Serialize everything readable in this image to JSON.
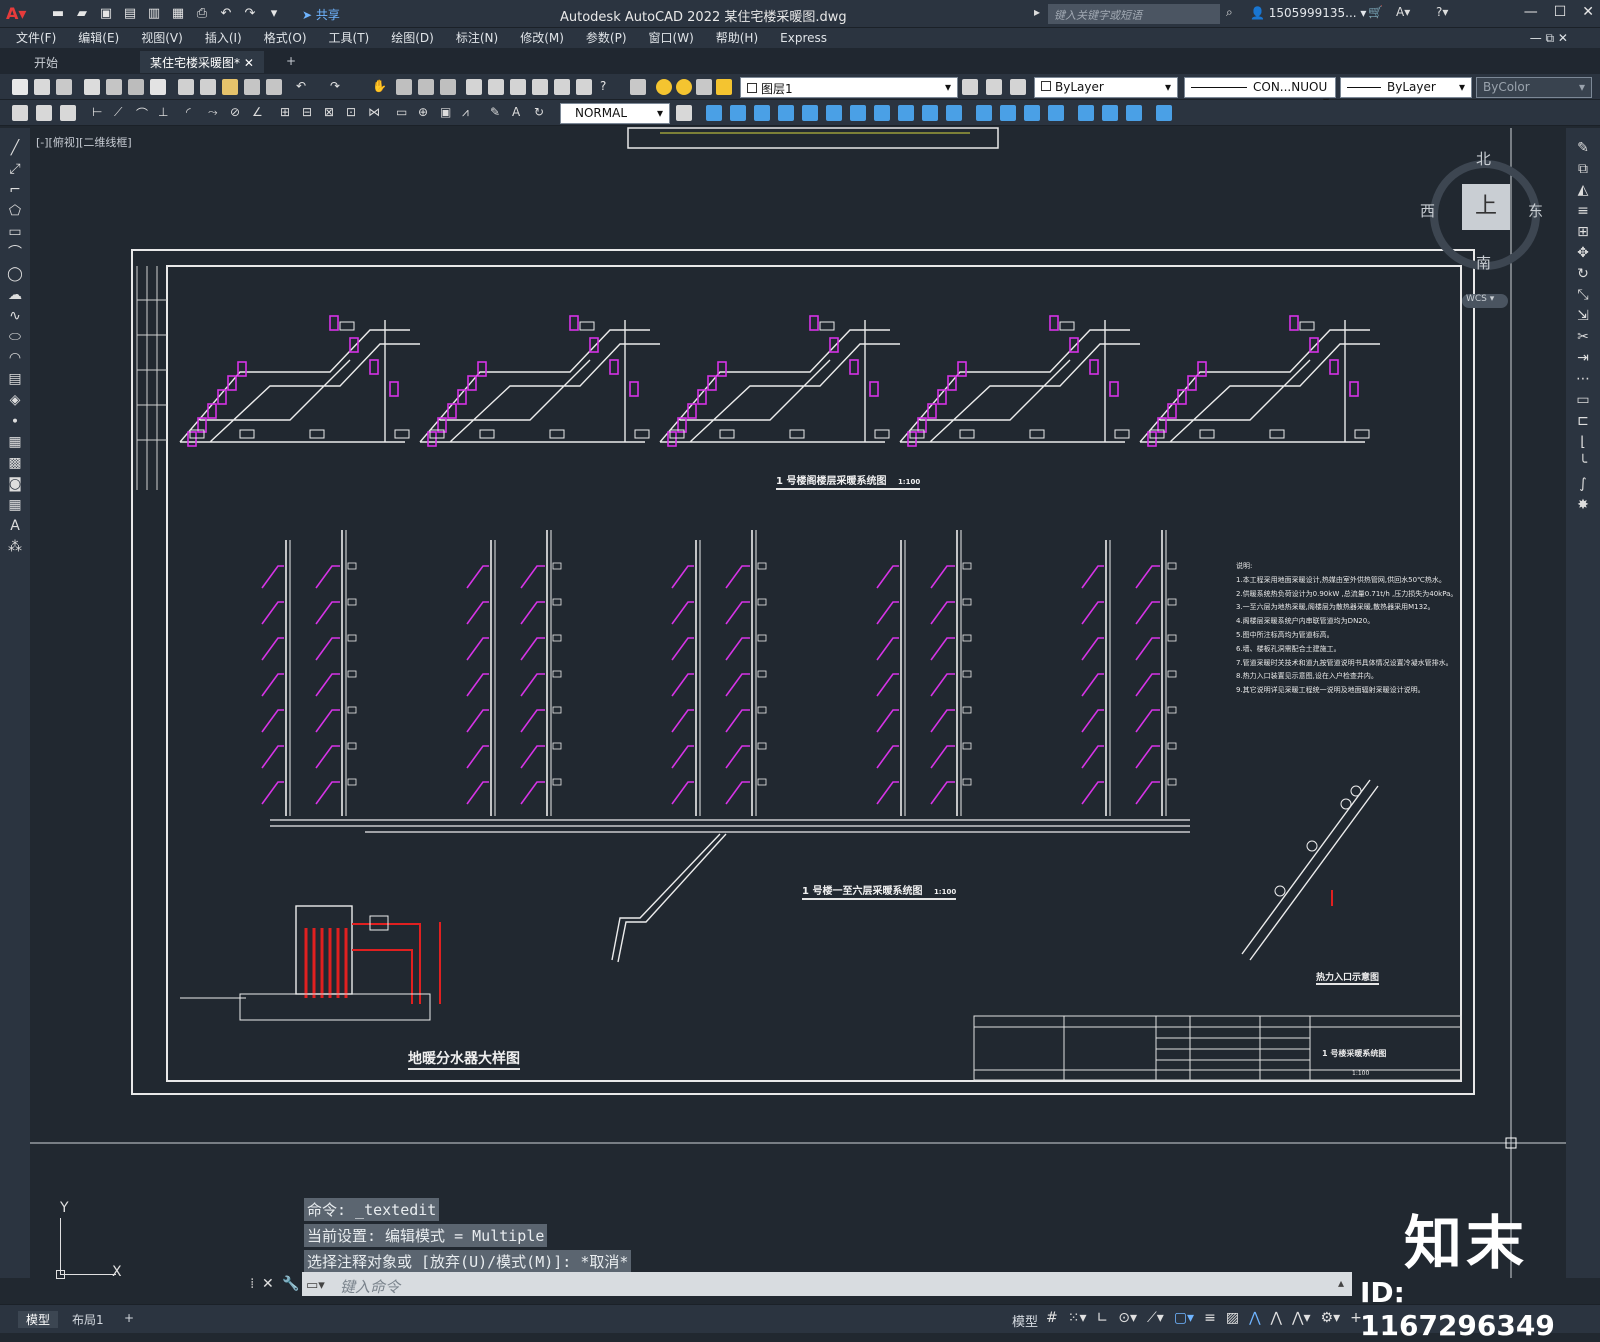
{
  "app": {
    "window_title": "Autodesk AutoCAD 2022    某住宅楼采暖图.dwg",
    "share_label": "共享",
    "search_placeholder": "键入关键字或短语",
    "user": "1505999135... ▾"
  },
  "menu": [
    "文件(F)",
    "编辑(E)",
    "视图(V)",
    "插入(I)",
    "格式(O)",
    "工具(T)",
    "绘图(D)",
    "标注(N)",
    "修改(M)",
    "参数(P)",
    "窗口(W)",
    "帮助(H)",
    "Express"
  ],
  "tabs": {
    "start": "开始",
    "drawing": "某住宅楼采暖图*",
    "close": "✕",
    "add": "+"
  },
  "toolbar": {
    "layer": "图层1",
    "color": "ByLayer",
    "linetype": "CON...NUOU",
    "lineweight": "ByLayer",
    "plotstyle": "ByColor",
    "textstyle": "NORMAL"
  },
  "viewport": {
    "label": "[-][俯视][二维线框]"
  },
  "viewcube": {
    "north": "北",
    "south": "南",
    "east": "东",
    "west": "西",
    "top": "上",
    "wcs": "WCS"
  },
  "drawing": {
    "title1": "1 号楼阁楼层采暖系统图",
    "scale1": "1:100",
    "title2": "1 号楼一至六层采暖系统图",
    "scale2": "1:100",
    "title3": "地暖分水器大样图",
    "title4": "热力入口示意图",
    "notes_heading": "说明:",
    "notes": [
      "1.本工程采用地面采暖设计,热媒由室外供热管网,供回水50℃热水。",
      "2.供暖系统热负荷设计为0.90kW ,总流量0.71t/h ,压力损失为40kPa。",
      "3.一至六层为地热采暖,阁楼层为散热器采暖,散热器采用M132。",
      "4.阁楼层采暖系统户内串联管道均为DN20。",
      "5.图中所注标高均为管道标高。",
      "6.墙、楼板孔洞需配合土建施工。",
      "7.管道采暖时关技术和道九按管道说明书具体情况设置冷凝水管排水。",
      "8.热力入口装置见示意图,设在入户检查井内。",
      "9.其它说明详见采暖工程统一说明及地面辐射采暖设计说明。"
    ],
    "titleblock": {
      "sheet": "1 号楼采暖系统图",
      "scale": "1:100"
    }
  },
  "command": {
    "history": [
      "命令: _textedit",
      "当前设置: 编辑模式 = Multiple",
      "选择注释对象或 [放弃(U)/模式(M)]: *取消*"
    ],
    "placeholder": "键入命令"
  },
  "status": {
    "model_tab": "模型",
    "layout_tab": "布局1",
    "add": "+",
    "model": "模型"
  },
  "ucs": {
    "y": "Y",
    "x": "X"
  },
  "watermark": {
    "brand": "知末",
    "id": "ID: 1167296349"
  }
}
